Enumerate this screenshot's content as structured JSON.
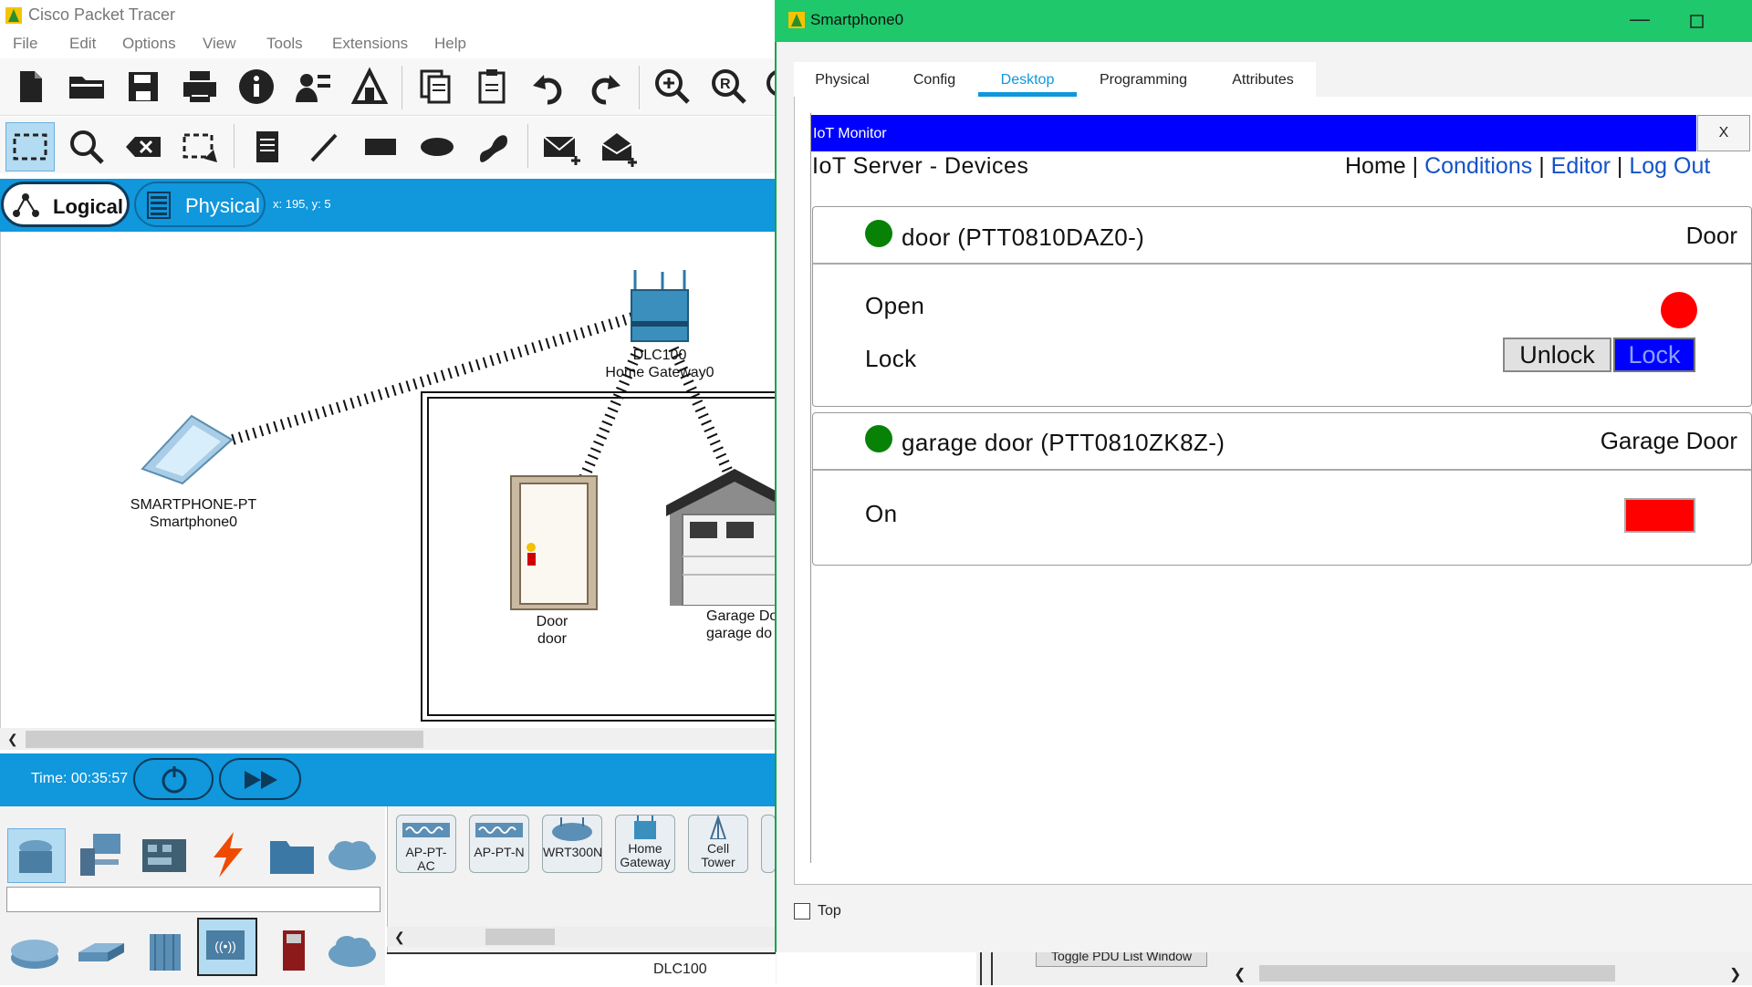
{
  "app": {
    "title": "Cisco Packet Tracer",
    "menu": [
      "File",
      "Edit",
      "Options",
      "View",
      "Tools",
      "Extensions",
      "Help"
    ]
  },
  "mode": {
    "logical_label": "Logical",
    "physical_label": "Physical",
    "coords": "x: 195, y: 5"
  },
  "workspace": {
    "smartphone": {
      "model": "SMARTPHONE-PT",
      "name": "Smartphone0"
    },
    "gateway": {
      "model": "DLC100",
      "name": "Home Gateway0"
    },
    "door": {
      "model": "Door",
      "name": "door"
    },
    "garage": {
      "model": "Garage Do",
      "name": "garage do"
    }
  },
  "time": {
    "label": "Time: 00:35:57"
  },
  "device_palette": {
    "items": [
      {
        "label": "AP-PT-AC"
      },
      {
        "label": "AP-PT-N"
      },
      {
        "label": "WRT300N"
      },
      {
        "label": "Home Gateway"
      },
      {
        "label": "Cell Tower"
      }
    ],
    "status_label": "DLC100"
  },
  "behind": {
    "pdu_button": "Toggle PDU List Window"
  },
  "smartphone_window": {
    "title": "Smartphone0",
    "tabs": [
      "Physical",
      "Config",
      "Desktop",
      "Programming",
      "Attributes"
    ],
    "active_tab": "Desktop",
    "top_label": "Top"
  },
  "iot": {
    "header": "IoT Monitor",
    "close": "X",
    "heading": "IoT Server - Devices",
    "nav": {
      "home": "Home",
      "conditions": "Conditions",
      "editor": "Editor",
      "logout": "Log Out",
      "sep": "|"
    },
    "devices": [
      {
        "name": "door (PTT0810DAZ0-)",
        "type": "Door",
        "status_color": "#078207",
        "attributes": [
          {
            "label": "Open",
            "indicator": "red-circle"
          },
          {
            "label": "Lock",
            "buttons": [
              "Unlock",
              "Lock"
            ],
            "selected": "Lock"
          }
        ]
      },
      {
        "name": "garage door (PTT0810ZK8Z-)",
        "type": "Garage Door",
        "status_color": "#078207",
        "attributes": [
          {
            "label": "On",
            "indicator": "red-rect"
          }
        ]
      }
    ]
  },
  "colors": {
    "accent_blue": "#1097dc",
    "iot_header_blue": "#0000ff",
    "window_green": "#1ec86b",
    "status_green": "#078207",
    "indicator_red": "#ff0000",
    "link_blue": "#1452c8"
  }
}
